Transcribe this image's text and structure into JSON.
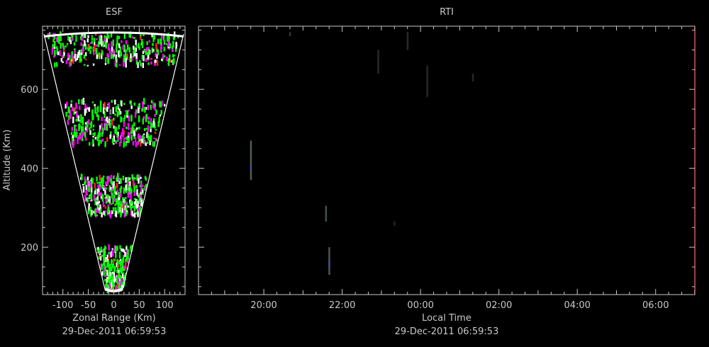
{
  "chart_data": [
    {
      "type": "scatter",
      "title": "ESF",
      "xlabel": "Zonal Range (Km)",
      "ylabel": "Altitude (Km)",
      "timestamp": "29-Dec-2011 06:59:53",
      "xlim": [
        -140,
        140
      ],
      "ylim": [
        80,
        760
      ],
      "x_ticks": [
        -100,
        -50,
        0,
        50,
        100
      ],
      "x_tick_labels": [
        "-100",
        "-50",
        "0",
        "50",
        "100"
      ],
      "y_ticks": [
        200,
        400,
        600
      ],
      "y_tick_labels": [
        "200",
        "400",
        "600"
      ],
      "beam_half_angle_deg": 10.5,
      "range_arcs_km": [
        740,
        90
      ],
      "colors": {
        "green": "#00ff00",
        "magenta": "#ff00ff",
        "red": "#ff2020",
        "white": "#ffffff",
        "frame": "#c8c8c8"
      },
      "echo_layers": [
        {
          "alt_range": [
            660,
            740
          ],
          "mix": {
            "green": 0.55,
            "magenta": 0.2,
            "white": 0.22,
            "red": 0.03
          }
        },
        {
          "alt_range": [
            460,
            570
          ],
          "mix": {
            "green": 0.5,
            "magenta": 0.22,
            "white": 0.22,
            "red": 0.06
          }
        },
        {
          "alt_range": [
            280,
            380
          ],
          "mix": {
            "green": 0.5,
            "magenta": 0.2,
            "white": 0.25,
            "red": 0.05
          }
        },
        {
          "alt_range": [
            90,
            200
          ],
          "mix": {
            "green": 0.55,
            "magenta": 0.15,
            "white": 0.25,
            "red": 0.05
          }
        }
      ]
    },
    {
      "type": "heatmap",
      "title": "RTI",
      "xlabel": "Local Time",
      "ylabel": "",
      "timestamp": "29-Dec-2011 06:59:53",
      "xlim": [
        "2011-12-28 18:20",
        "2011-12-29 07:00"
      ],
      "ylim": [
        80,
        760
      ],
      "x_ticks": [
        "2011-12-28 20:00",
        "2011-12-28 22:00",
        "2011-12-29 00:00",
        "2011-12-29 02:00",
        "2011-12-29 04:00",
        "2011-12-29 06:00"
      ],
      "x_tick_labels": [
        "20:00",
        "22:00",
        "00:00",
        "02:00",
        "04:00",
        "06:00"
      ],
      "y_ticks": [
        200,
        400,
        600
      ],
      "traces": [
        {
          "time": "2011-12-28 19:40",
          "alt_range": [
            370,
            470
          ],
          "color": "#5a6a5a"
        },
        {
          "time": "2011-12-28 19:40",
          "alt_range": [
            395,
            410
          ],
          "color": "#4a4aa0"
        },
        {
          "time": "2011-12-28 21:35",
          "alt_range": [
            265,
            305
          ],
          "color": "#4a5a5a"
        },
        {
          "time": "2011-12-28 21:40",
          "alt_range": [
            130,
            200
          ],
          "color": "#506060"
        },
        {
          "time": "2011-12-28 21:40",
          "alt_range": [
            150,
            165
          ],
          "color": "#4050a0"
        },
        {
          "time": "2011-12-28 20:40",
          "alt_range": [
            735,
            745
          ],
          "color": "#3a3a3a"
        },
        {
          "time": "2011-12-28 22:55",
          "alt_range": [
            640,
            700
          ],
          "color": "#2e2e2e"
        },
        {
          "time": "2011-12-28 23:40",
          "alt_range": [
            700,
            745
          ],
          "color": "#2e2e2e"
        },
        {
          "time": "2011-12-29 00:10",
          "alt_range": [
            580,
            660
          ],
          "color": "#2a2a2a"
        },
        {
          "time": "2011-12-29 01:20",
          "alt_range": [
            620,
            640
          ],
          "color": "#2a2a2a"
        },
        {
          "time": "2011-12-28 23:20",
          "alt_range": [
            255,
            265
          ],
          "color": "#2a2a2a"
        }
      ]
    }
  ]
}
